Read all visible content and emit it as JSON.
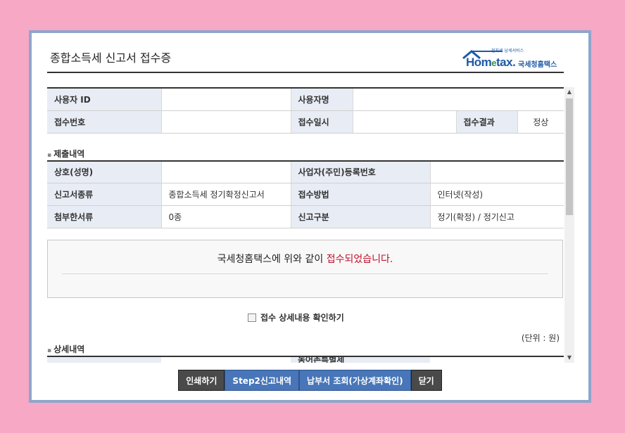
{
  "window": {
    "title": "종합소득세 신고서 접수증"
  },
  "logo": {
    "small_text": "전자세 납세서비스",
    "main_ho": "Hom",
    "main_e": "e",
    "main_tax": "tax.",
    "korean": "국세청홈택스"
  },
  "basic_info": {
    "user_id_label": "사용자 ID",
    "user_id_value": "",
    "user_name_label": "사용자명",
    "user_name_value": "",
    "receipt_no_label": "접수번호",
    "receipt_no_value": "",
    "receipt_date_label": "접수일시",
    "receipt_date_value": "",
    "receipt_result_label": "접수결과",
    "receipt_result_value": "정상"
  },
  "submission": {
    "section_title": "제출내역",
    "trade_name_label": "상호(성명)",
    "trade_name_value": "",
    "reg_no_label": "사업자(주민)등록번호",
    "reg_no_value": "",
    "report_type_label": "신고서종류",
    "report_type_value": "종합소득세 정기확정신고서",
    "method_label": "접수방법",
    "method_value": "인터넷(작성)",
    "attached_label": "첨부한서류",
    "attached_value": "0종",
    "category_label": "신고구분",
    "category_value": "정기(확정) / 정기신고"
  },
  "notice": {
    "prefix": "국세청홈택스에 위와 같이 ",
    "highlight": "접수되었습니다."
  },
  "check": {
    "label": "접수 상세내용 확인하기",
    "checked": false
  },
  "detail": {
    "section_title": "상세내역",
    "unit": "(단위 : 원)",
    "partial_label": "농어촌특별세"
  },
  "buttons": {
    "print": "인쇄하기",
    "step2": "Step2신고내역",
    "payment": "납부서 조회(가상계좌확인)",
    "close": "닫기"
  },
  "colors": {
    "background": "#f7a8c4",
    "window_border": "#8fa6cc",
    "header_cell": "#e8ecf5",
    "highlight_red": "#c0102a",
    "button_dark": "#4a4a4a",
    "button_blue": "#4876b8"
  }
}
